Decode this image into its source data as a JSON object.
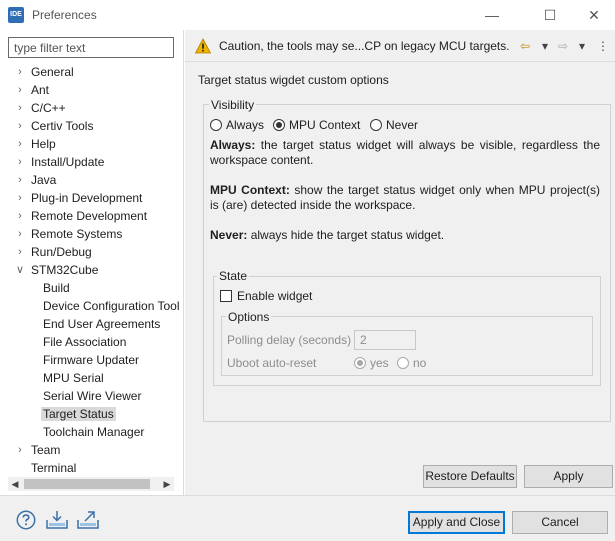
{
  "window": {
    "app_icon": "IDE",
    "title": "Preferences",
    "controls": {
      "minimize": "—",
      "maximize": "☐",
      "close": "✕"
    }
  },
  "filter": {
    "placeholder": "type filter text"
  },
  "tree": {
    "items": [
      {
        "label": "General",
        "indent": 0,
        "twisty": "collapsed"
      },
      {
        "label": "Ant",
        "indent": 0,
        "twisty": "collapsed"
      },
      {
        "label": "C/C++",
        "indent": 0,
        "twisty": "collapsed"
      },
      {
        "label": "Certiv Tools",
        "indent": 0,
        "twisty": "collapsed"
      },
      {
        "label": "Help",
        "indent": 0,
        "twisty": "collapsed"
      },
      {
        "label": "Install/Update",
        "indent": 0,
        "twisty": "collapsed"
      },
      {
        "label": "Java",
        "indent": 0,
        "twisty": "collapsed"
      },
      {
        "label": "Plug-in Development",
        "indent": 0,
        "twisty": "collapsed"
      },
      {
        "label": "Remote Development",
        "indent": 0,
        "twisty": "collapsed"
      },
      {
        "label": "Remote Systems",
        "indent": 0,
        "twisty": "collapsed"
      },
      {
        "label": "Run/Debug",
        "indent": 0,
        "twisty": "collapsed"
      },
      {
        "label": "STM32Cube",
        "indent": 0,
        "twisty": "expanded"
      },
      {
        "label": "Build",
        "indent": 1,
        "twisty": "none"
      },
      {
        "label": "Device Configuration Tool",
        "indent": 1,
        "twisty": "none"
      },
      {
        "label": "End User Agreements",
        "indent": 1,
        "twisty": "none"
      },
      {
        "label": "File Association",
        "indent": 1,
        "twisty": "none"
      },
      {
        "label": "Firmware Updater",
        "indent": 1,
        "twisty": "none"
      },
      {
        "label": "MPU Serial",
        "indent": 1,
        "twisty": "none"
      },
      {
        "label": "Serial Wire Viewer",
        "indent": 1,
        "twisty": "none"
      },
      {
        "label": "Target Status",
        "indent": 1,
        "twisty": "none",
        "selected": true
      },
      {
        "label": "Toolchain Manager",
        "indent": 1,
        "twisty": "none"
      },
      {
        "label": "Team",
        "indent": 0,
        "twisty": "collapsed"
      },
      {
        "label": "Terminal",
        "indent": 0,
        "twisty": "none"
      }
    ]
  },
  "message": {
    "icon": "warning-icon",
    "text": "Caution, the tools may se...CP on legacy MCU targets."
  },
  "nav": {
    "back": "⇦",
    "back_menu": "▾",
    "forward": "⇨",
    "forward_menu": "▾",
    "more": "⋮"
  },
  "page": {
    "title": "Target status wigdet custom options",
    "visibility": {
      "label": "Visibility",
      "options": [
        {
          "label": "Always",
          "checked": false
        },
        {
          "label": "MPU Context",
          "checked": true
        },
        {
          "label": "Never",
          "checked": false
        }
      ],
      "always_term": "Always:",
      "always_text": " the target status widget will always be visible, regardless the workspace content.",
      "mpu_term": "MPU Context:",
      "mpu_text": " show the target status widget only when MPU project(s) is (are) detected inside the workspace.",
      "never_term": "Never:",
      "never_text": " always hide the target status widget."
    },
    "state": {
      "label": "State",
      "enable_label": "Enable widget",
      "enabled": false,
      "options_label": "Options",
      "polling_label": "Polling delay (seconds)",
      "polling_value": "2",
      "uboot_label": "Uboot auto-reset",
      "uboot_options": [
        {
          "label": "yes",
          "checked": true
        },
        {
          "label": "no",
          "checked": false
        }
      ]
    }
  },
  "buttons": {
    "restore_defaults": "Restore Defaults",
    "apply": "Apply",
    "apply_and_close": "Apply and Close",
    "cancel": "Cancel"
  },
  "scrollbar": {
    "left_arrow": "◀",
    "right_arrow": "▶"
  },
  "colors": {
    "accent": "#0078d7",
    "warning": "#f0b400",
    "selection": "#d9d9d9",
    "panel": "#f0f0f0"
  }
}
